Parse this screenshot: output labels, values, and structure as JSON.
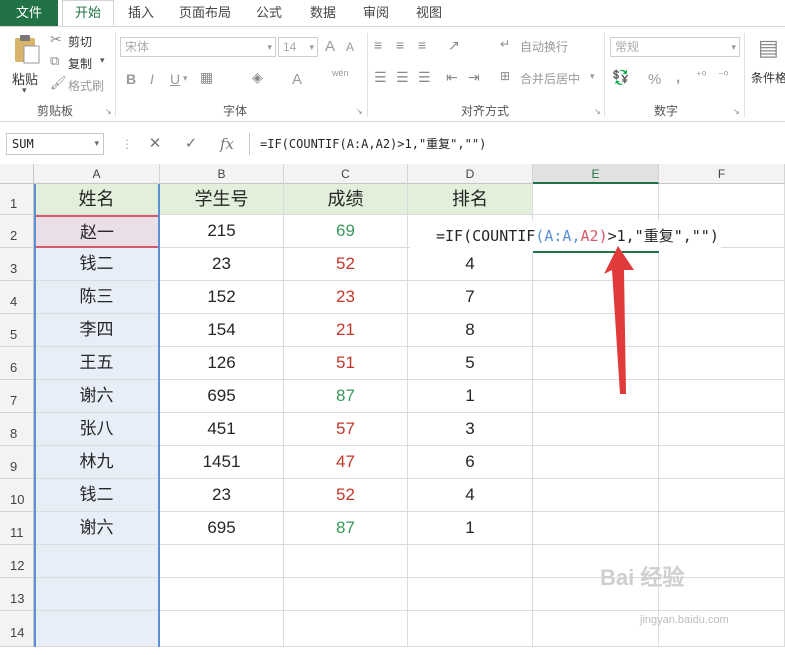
{
  "menu": {
    "tabs": [
      "文件",
      "开始",
      "插入",
      "页面布局",
      "公式",
      "数据",
      "审阅",
      "视图"
    ],
    "active": "开始"
  },
  "ribbon": {
    "clipboard": {
      "paste": "粘贴",
      "cut": "剪切",
      "copy": "复制",
      "format_painter": "格式刷",
      "label": "剪贴板"
    },
    "font": {
      "font_name": "宋体",
      "font_size": "14",
      "grow": "A",
      "shrink": "A",
      "bold": "B",
      "italic": "I",
      "underline": "U",
      "font_color": "A",
      "wen": "wén",
      "label": "字体"
    },
    "alignment": {
      "wrap": "自动换行",
      "merge": "合并后居中",
      "label": "对齐方式"
    },
    "number": {
      "format": "常规",
      "percent": "%",
      "comma": ",",
      "label": "数字"
    },
    "styles": {
      "conditional": "条件格"
    }
  },
  "formula_bar": {
    "name_box": "SUM",
    "cancel": "✕",
    "enter": "✓",
    "fx": "fx",
    "formula": "=IF(COUNTIF(A:A,A2)>1,\"重复\",\"\")"
  },
  "editing_cell": {
    "part1": "=IF(COUNTIF",
    "paren_open": "(",
    "ref1": "A:A",
    "comma": ",",
    "ref2": "A2",
    "paren_close": ")",
    "part2": ">1,\"重复\",\"\")"
  },
  "grid": {
    "columns": [
      "A",
      "B",
      "C",
      "D",
      "E",
      "F"
    ],
    "row_numbers": [
      "1",
      "2",
      "3",
      "4",
      "5",
      "6",
      "7",
      "8",
      "9",
      "10",
      "11",
      "12",
      "13",
      "14"
    ],
    "header": [
      "姓名",
      "学生号",
      "成绩",
      "排名"
    ],
    "rows": [
      {
        "name": "赵一",
        "id": "215",
        "score": "69",
        "score_color": "green",
        "rank": ""
      },
      {
        "name": "钱二",
        "id": "23",
        "score": "52",
        "score_color": "red",
        "rank": "4"
      },
      {
        "name": "陈三",
        "id": "152",
        "score": "23",
        "score_color": "red",
        "rank": "7"
      },
      {
        "name": "李四",
        "id": "154",
        "score": "21",
        "score_color": "red",
        "rank": "8"
      },
      {
        "name": "王五",
        "id": "126",
        "score": "51",
        "score_color": "red",
        "rank": "5"
      },
      {
        "name": "谢六",
        "id": "695",
        "score": "87",
        "score_color": "green",
        "rank": "1"
      },
      {
        "name": "张八",
        "id": "451",
        "score": "57",
        "score_color": "red",
        "rank": "3"
      },
      {
        "name": "林九",
        "id": "1451",
        "score": "47",
        "score_color": "red",
        "rank": "6"
      },
      {
        "name": "钱二",
        "id": "23",
        "score": "52",
        "score_color": "red",
        "rank": "4"
      },
      {
        "name": "谢六",
        "id": "695",
        "score": "87",
        "score_color": "green",
        "rank": "1"
      }
    ]
  },
  "colors": {
    "excel_green": "#217346",
    "header_fill": "#e2efda",
    "arrow_red": "#e03a3a"
  },
  "watermark": {
    "text": "Bai 经验",
    "sub": "jingyan.baidu.com"
  }
}
